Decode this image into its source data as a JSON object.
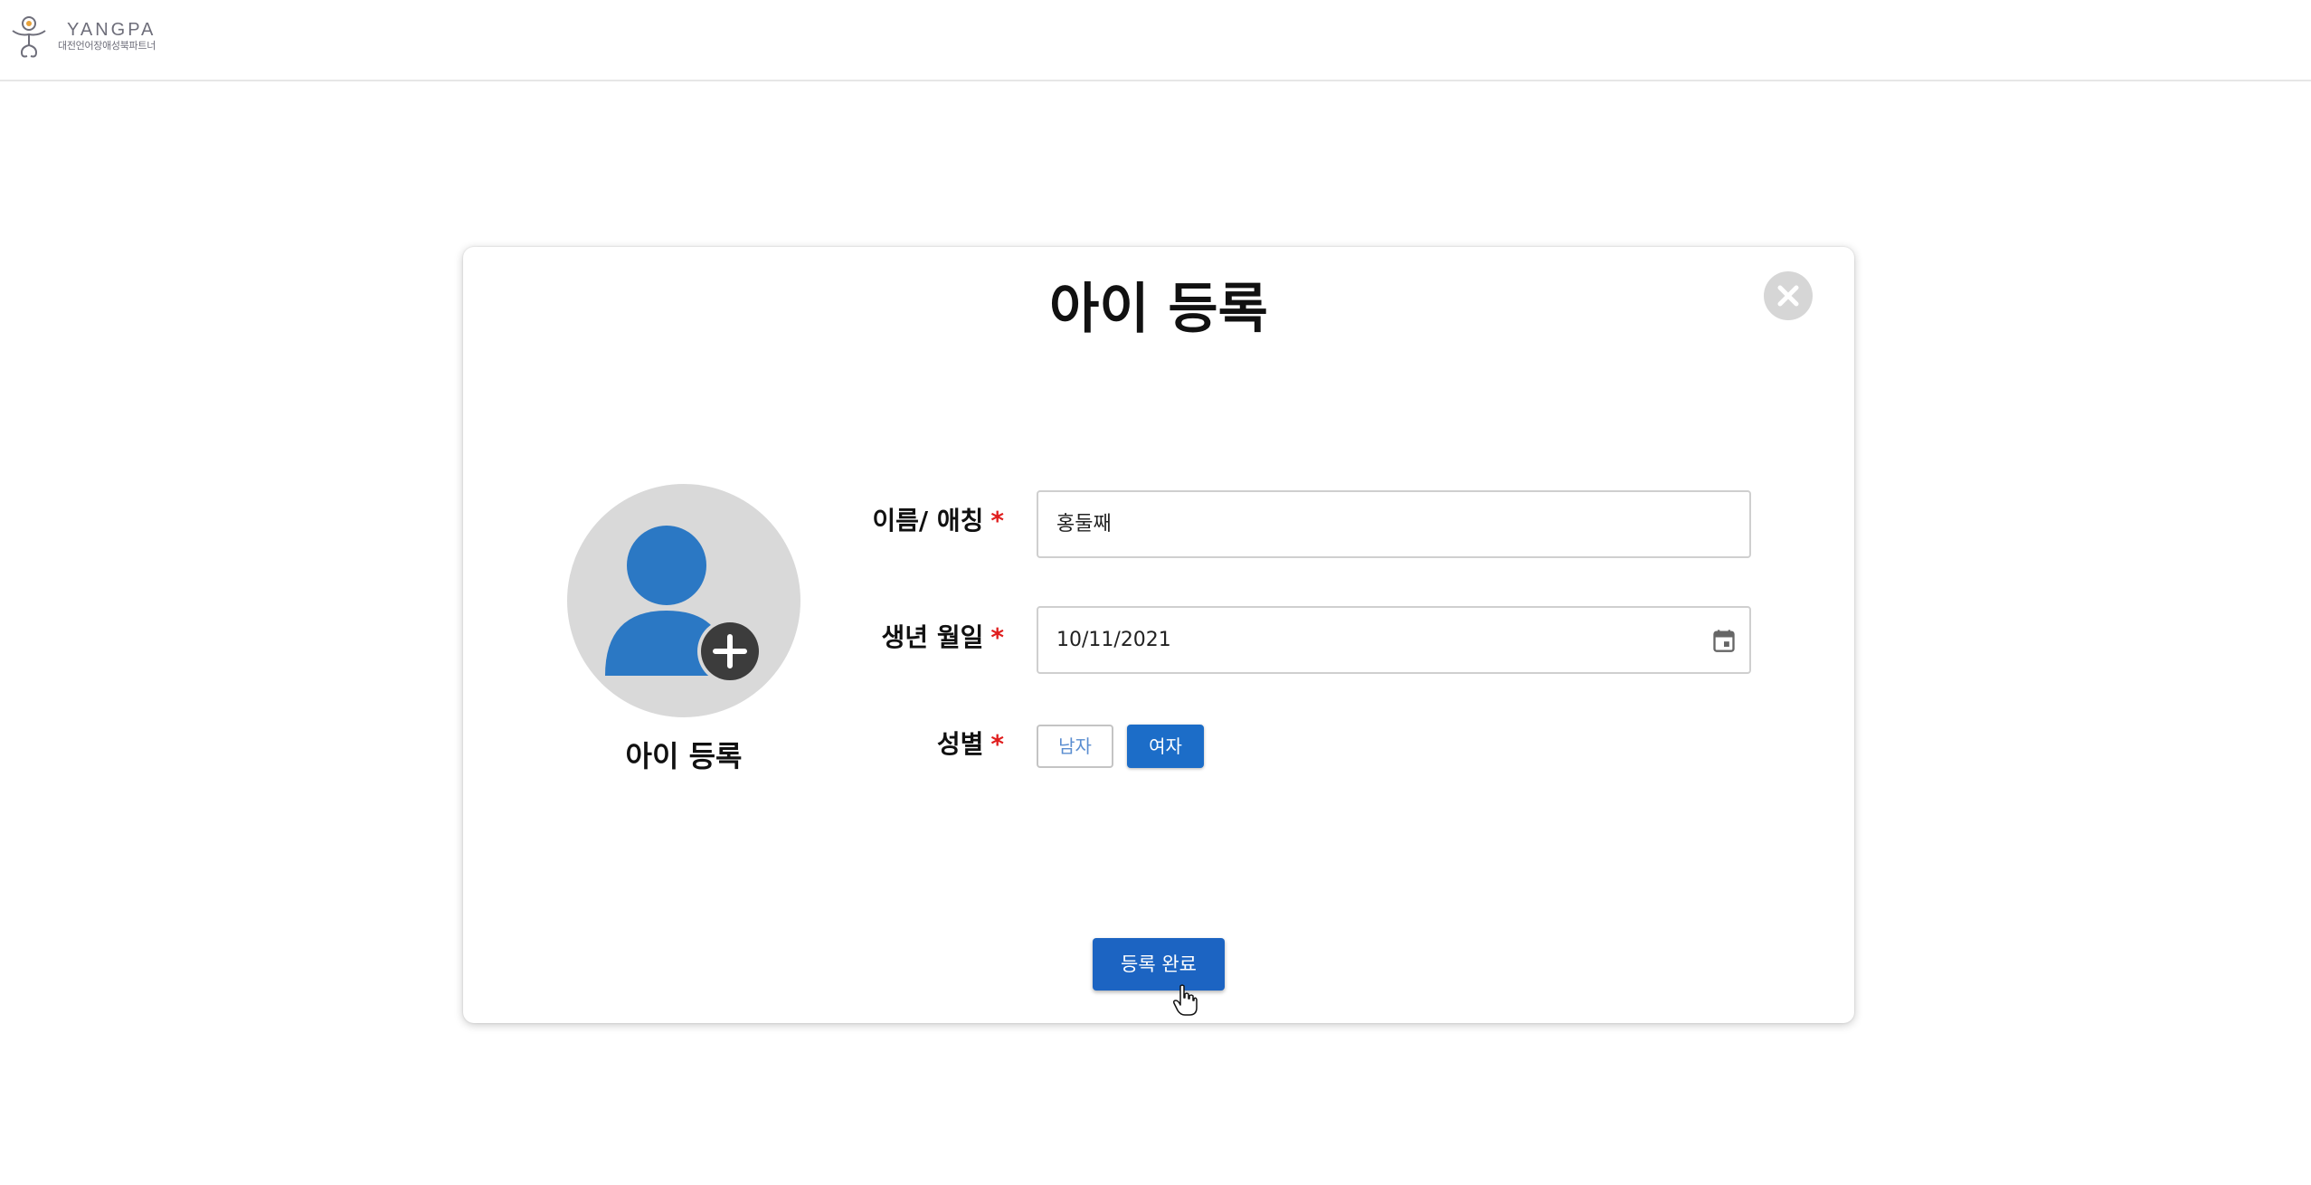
{
  "header": {
    "logo_title": "YANGPA",
    "logo_subtitle": "대전언어장애성북파트너"
  },
  "modal": {
    "title": "아이 등록",
    "avatar_caption": "아이 등록",
    "required_mark": "*",
    "fields": {
      "name": {
        "label": "이름/ 애칭",
        "value": "홍둘째"
      },
      "birthdate": {
        "label": "생년 월일",
        "value": "10/11/2021"
      },
      "gender": {
        "label": "성별",
        "options": [
          "남자",
          "여자"
        ],
        "selected": "여자"
      }
    },
    "submit_label": "등록 완료"
  },
  "colors": {
    "primary": "#1c64c2",
    "required": "#e01e1e",
    "avatar_bg": "#d9d9d9",
    "avatar_figure": "#2b78c4",
    "close_bg": "#d6d6d6"
  },
  "icons": {
    "close": "close-icon",
    "avatar": "person-icon",
    "add": "plus-circle-icon",
    "calendar": "calendar-icon"
  }
}
